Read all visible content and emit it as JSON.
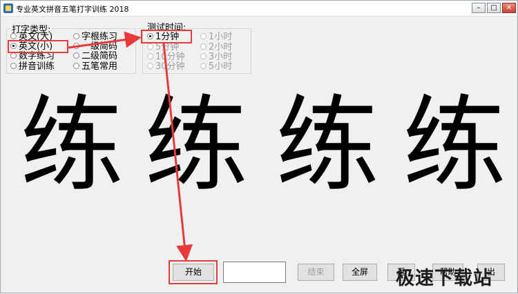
{
  "window": {
    "title": "专业英文拼音五笔打字训练 2018"
  },
  "typing_type": {
    "group_label": "打字类型:",
    "options": [
      {
        "label": "英文(大)",
        "selected": false,
        "enabled": true
      },
      {
        "label": "英文(小)",
        "selected": true,
        "enabled": true
      },
      {
        "label": "数字练习",
        "selected": false,
        "enabled": true
      },
      {
        "label": "拼音训练",
        "selected": false,
        "enabled": true
      },
      {
        "label": "字根练习",
        "selected": false,
        "enabled": true
      },
      {
        "label": "一级简码",
        "selected": false,
        "enabled": true
      },
      {
        "label": "二级简码",
        "selected": false,
        "enabled": true
      },
      {
        "label": "五笔常用",
        "selected": false,
        "enabled": true
      }
    ]
  },
  "test_time": {
    "group_label": "测试时间:",
    "options": [
      {
        "label": "1分钟",
        "selected": true,
        "enabled": true
      },
      {
        "label": "5分钟",
        "selected": false,
        "enabled": false
      },
      {
        "label": "10分钟",
        "selected": false,
        "enabled": false
      },
      {
        "label": "30分钟",
        "selected": false,
        "enabled": false
      },
      {
        "label": "1小时",
        "selected": false,
        "enabled": false
      },
      {
        "label": "2小时",
        "selected": false,
        "enabled": false
      },
      {
        "label": "3小时",
        "selected": false,
        "enabled": false
      },
      {
        "label": "5小时",
        "selected": false,
        "enabled": false
      }
    ]
  },
  "display_chars": [
    "练",
    "练",
    "练",
    "练"
  ],
  "controls": {
    "start_label": "开始",
    "input_value": "",
    "end_label": "结束",
    "fullscreen_label": "全屏",
    "return_label": "返",
    "help_label": "帮助",
    "exit_label": "出"
  },
  "watermark": "极速下载站",
  "colors": {
    "highlight": "#e83a3a",
    "background": "#f0f0f0"
  }
}
